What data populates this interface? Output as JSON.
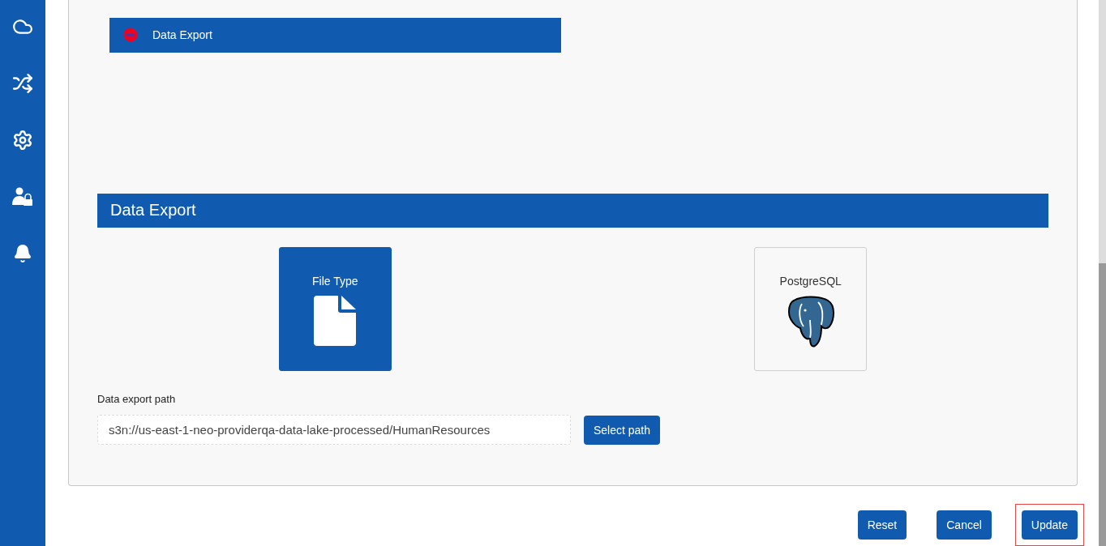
{
  "sidebar": {
    "items": [
      {
        "kind": "cloud",
        "selected": false
      },
      {
        "kind": "flow",
        "selected": false
      },
      {
        "kind": "gear",
        "selected": false
      },
      {
        "kind": "user-lock",
        "selected": false
      },
      {
        "kind": "bell",
        "selected": false
      }
    ]
  },
  "steps": [
    {
      "label": "Data Export",
      "selected": true
    }
  ],
  "section": {
    "title": "Data Export",
    "options": [
      {
        "label": "File Type",
        "kind": "file",
        "selected": true
      },
      {
        "label": "PostgreSQL",
        "kind": "postgres",
        "selected": false
      }
    ],
    "path_label": "Data export path",
    "path_value": "s3n://us-east-1-neo-providerqa-data-lake-processed/HumanResources",
    "path_button": "Select path"
  },
  "buttons": [
    {
      "label": "Reset",
      "highlighted": false
    },
    {
      "label": "Cancel",
      "highlighted": false
    },
    {
      "label": "Update",
      "highlighted": true
    }
  ]
}
